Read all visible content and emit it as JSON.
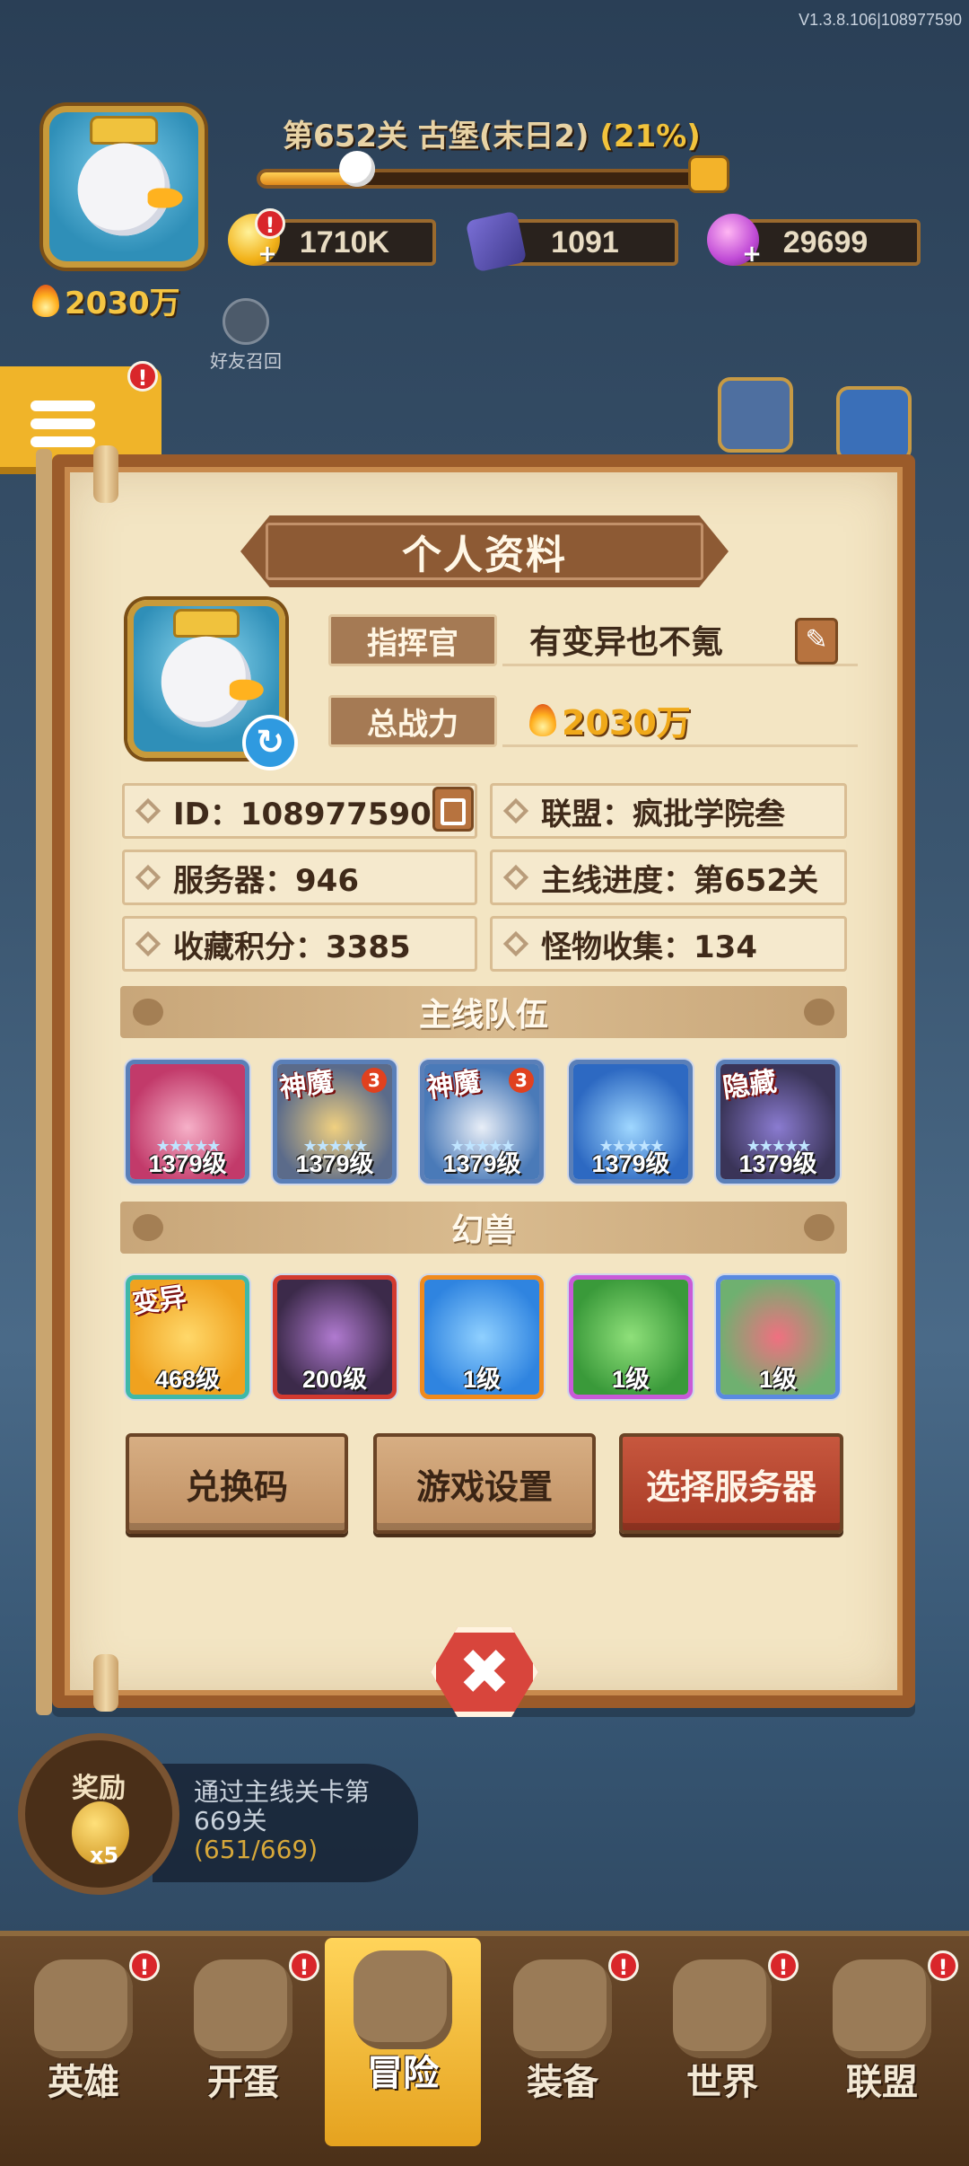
{
  "version": "V1.3.8.106|108977590",
  "hud": {
    "power": "2030万",
    "level_title": "第652关 古堡(末日2)",
    "level_pct": "(21%)",
    "level_progress": 0.21,
    "gold": "1710K",
    "book": "1091",
    "gem": "29699",
    "friend_recall": "好友召回",
    "badge_mark": "!"
  },
  "dialog": {
    "title": "个人资料",
    "commander_label": "指挥官",
    "commander_name": "有变异也不氪",
    "power_label": "总战力",
    "power_value": "2030万",
    "id": "ID：108977590",
    "alliance": "联盟：疯批学院叁",
    "server": "服务器：946",
    "main_progress": "主线进度：第652关",
    "collection": "收藏积分：3385",
    "monsters": "怪物收集：134",
    "team_title": "主线队伍",
    "beast_title": "幻兽",
    "team": [
      {
        "level": "1379级",
        "tag": "",
        "star": "",
        "colors": [
          "#c23a6a",
          "#f6b0c8"
        ]
      },
      {
        "level": "1379级",
        "tag": "神魔",
        "star": "3",
        "colors": [
          "#5b6b8a",
          "#f0d080"
        ]
      },
      {
        "level": "1379级",
        "tag": "神魔",
        "star": "3",
        "colors": [
          "#4a7ab8",
          "#e8eef7"
        ]
      },
      {
        "level": "1379级",
        "tag": "",
        "star": "",
        "colors": [
          "#2d69c2",
          "#9fd7ff"
        ]
      },
      {
        "level": "1379级",
        "tag": "隐藏",
        "star": "",
        "colors": [
          "#3a3458",
          "#8a7bd0"
        ]
      }
    ],
    "beasts": [
      {
        "level": "468级",
        "tag": "变异",
        "border": "#3fb8a8",
        "colors": [
          "#f0a21f",
          "#ffd86a"
        ]
      },
      {
        "level": "200级",
        "tag": "",
        "border": "#d23a2f",
        "colors": [
          "#3c2a4a",
          "#b07ad0"
        ]
      },
      {
        "level": "1级",
        "tag": "",
        "border": "#f08a1c",
        "colors": [
          "#2f84e0",
          "#8fd0ff"
        ]
      },
      {
        "level": "1级",
        "tag": "",
        "border": "#c85ad8",
        "colors": [
          "#3a9a3a",
          "#8fe07a"
        ]
      },
      {
        "level": "1级",
        "tag": "",
        "border": "#5a8ae0",
        "colors": [
          "#6fb070",
          "#f07080"
        ]
      }
    ],
    "buttons": {
      "redeem": "兑换码",
      "settings": "游戏设置",
      "server": "选择服务器"
    }
  },
  "reward": {
    "title": "奖励",
    "count": "x5",
    "text": "通过主线关卡第669关",
    "progress": "(651/669)"
  },
  "nav": [
    {
      "label": "英雄",
      "icon": "hero-icon",
      "active": false,
      "badge": true
    },
    {
      "label": "开蛋",
      "icon": "egg-icon",
      "active": false,
      "badge": true
    },
    {
      "label": "冒险",
      "icon": "swords-icon",
      "active": true,
      "badge": false
    },
    {
      "label": "装备",
      "icon": "anvil-icon",
      "active": false,
      "badge": true
    },
    {
      "label": "世界",
      "icon": "map-icon",
      "active": false,
      "badge": true
    },
    {
      "label": "联盟",
      "icon": "shield-icon",
      "active": false,
      "badge": true
    }
  ]
}
